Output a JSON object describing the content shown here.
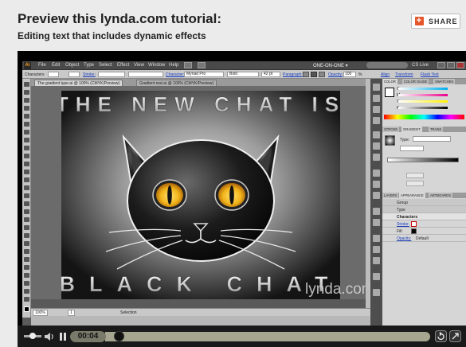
{
  "header": {
    "title": "Preview this lynda.com tutorial:",
    "subtitle": "Editing text that includes dynamic effects",
    "share_label": "SHARE"
  },
  "app": {
    "menu": [
      "File",
      "Edit",
      "Object",
      "Type",
      "Select",
      "Effect",
      "View",
      "Window",
      "Help"
    ],
    "workspace": "ONE-ON-ONE ▾",
    "search_label": "CS Live",
    "control_bar": {
      "selection": "Characters",
      "stroke_label": "Stroke:",
      "character_link": "Character:",
      "font": "Myriad Pro",
      "style": "Bold",
      "size": "42 pt",
      "paragraph_link": "Paragraph:",
      "opacity_label": "Opacity:",
      "opacity_value": "100",
      "opacity_unit": "%",
      "align_link": "Align",
      "transform_link": "Transform",
      "flash_link": "Flash Text"
    },
    "doc_tabs": [
      "The gradient type.ai @ 100% (CMYK/Preview)",
      "Gradient rest.ai @ 100% (CMYK/Preview)"
    ],
    "artwork": {
      "top_text": "THE NEW CHAT IS",
      "bottom_text": "BLACK CHAT"
    },
    "status": {
      "zoom": "100%",
      "page": "1",
      "tool": "Selection"
    },
    "panels": {
      "color_tabs": [
        "COLOR",
        "COLOR GUIDE",
        "SWATCHES"
      ],
      "cmyk": [
        "C",
        "M",
        "Y",
        "K"
      ],
      "gradient_tabs": [
        "STROKE",
        "GRADIENT",
        "TRANS"
      ],
      "gradient_type_label": "Type:",
      "appearance_tabs": [
        "LAYERS",
        "APPEARANCE",
        "ARTBOARDS"
      ],
      "appearance_rows": [
        {
          "label": "Group"
        },
        {
          "label": "Type"
        },
        {
          "label": "Characters"
        },
        {
          "label": "Stroke:"
        },
        {
          "label": "Fill:"
        },
        {
          "label": "Opacity:",
          "value": "Default"
        }
      ]
    },
    "watermark": "lynda.com"
  },
  "player": {
    "time": "00:04",
    "progress": 0.02
  },
  "colors": {
    "accent_share": "#e5572b",
    "cat_eye": "#f2b41a",
    "player_track": "#a6a690"
  }
}
